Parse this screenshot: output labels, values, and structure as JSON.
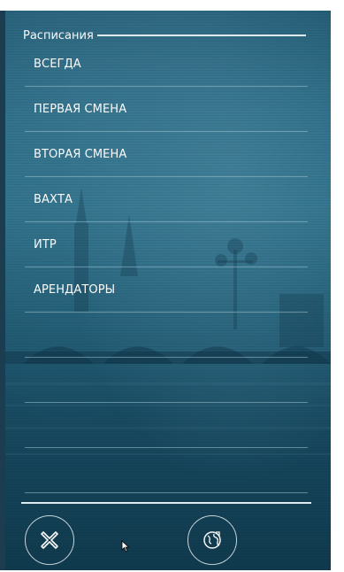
{
  "header": {
    "title": "Расписания"
  },
  "schedules": {
    "items": [
      {
        "label": "ВСЕГДА"
      },
      {
        "label": "ПЕРВАЯ СМЕНА"
      },
      {
        "label": "ВТОРАЯ СМЕНА"
      },
      {
        "label": "ВАХТА"
      },
      {
        "label": "ИТР"
      },
      {
        "label": "АРЕНДАТОРЫ"
      },
      {
        "label": ""
      },
      {
        "label": ""
      },
      {
        "label": ""
      },
      {
        "label": ""
      }
    ]
  },
  "footer": {
    "close_icon": "close-x-icon",
    "globe_icon": "globe-icon"
  },
  "colors": {
    "background_top": "#2a6a84",
    "background_bottom": "#103a4e",
    "text": "#ffffff",
    "divider": "#e6f1f5"
  }
}
